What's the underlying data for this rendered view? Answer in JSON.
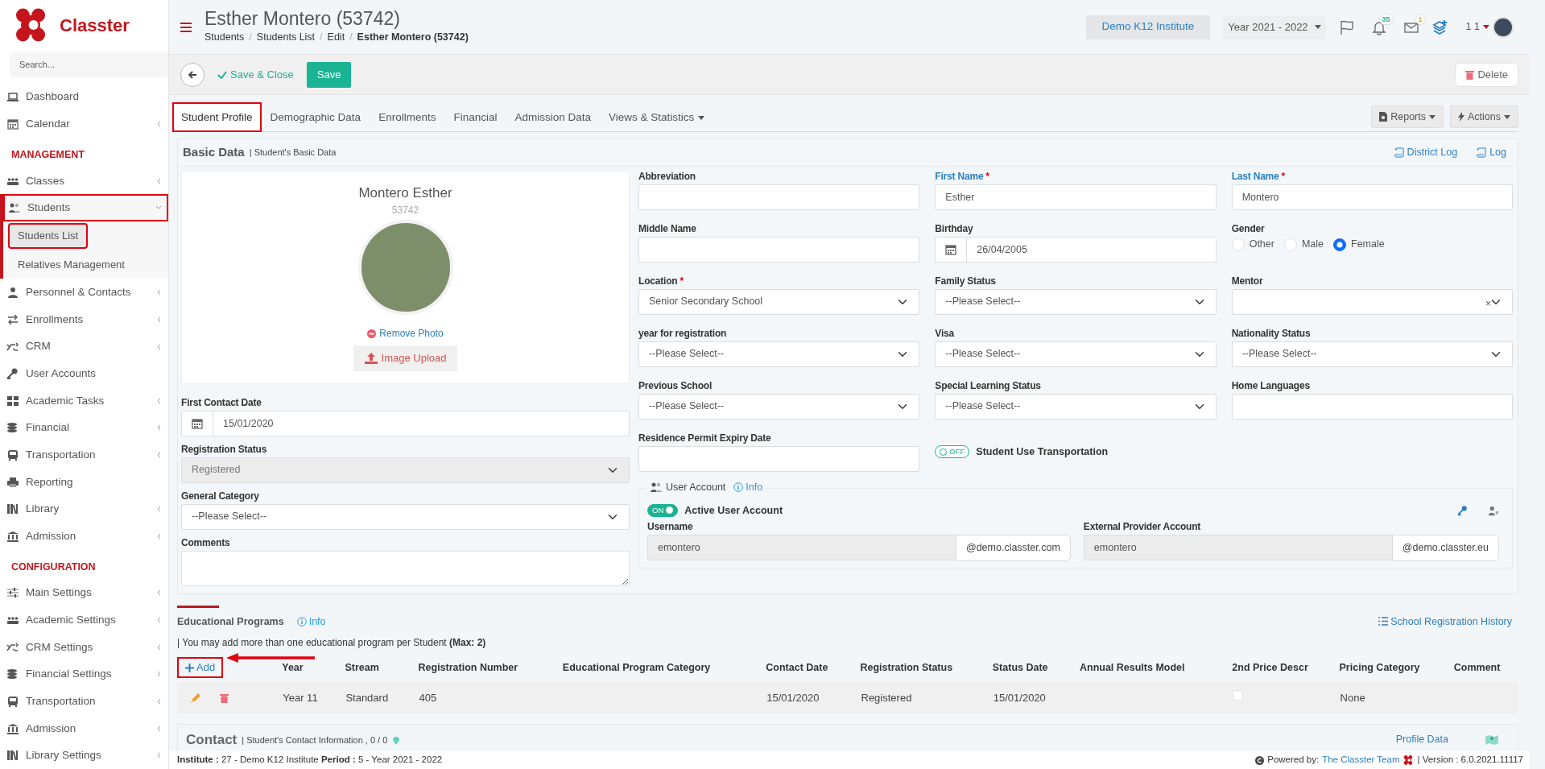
{
  "brand": {
    "name": "Classter"
  },
  "sidebar": {
    "search_placeholder": "Search...",
    "items": [
      {
        "kind": "item",
        "label": "Dashboard",
        "expandable": false,
        "expanded": false,
        "highlighted": false
      },
      {
        "kind": "item",
        "label": "Calendar",
        "expandable": true,
        "expanded": false,
        "highlighted": false
      },
      {
        "kind": "header",
        "label": "MANAGEMENT"
      },
      {
        "kind": "item",
        "label": "Classes",
        "expandable": true,
        "expanded": false,
        "highlighted": false
      },
      {
        "kind": "item",
        "label": "Students",
        "expandable": true,
        "expanded": true,
        "highlighted": true,
        "children": [
          {
            "label": "Students List",
            "selected": true,
            "highlighted": true
          },
          {
            "label": "Relatives Management",
            "selected": false,
            "highlighted": false
          }
        ]
      },
      {
        "kind": "item",
        "label": "Personnel & Contacts",
        "expandable": true,
        "expanded": false,
        "highlighted": false
      },
      {
        "kind": "item",
        "label": "Enrollments",
        "expandable": true,
        "expanded": false,
        "highlighted": false
      },
      {
        "kind": "item",
        "label": "CRM",
        "expandable": true,
        "expanded": false,
        "highlighted": false
      },
      {
        "kind": "item",
        "label": "User Accounts",
        "expandable": false,
        "expanded": false,
        "highlighted": false
      },
      {
        "kind": "item",
        "label": "Academic Tasks",
        "expandable": true,
        "expanded": false,
        "highlighted": false
      },
      {
        "kind": "item",
        "label": "Financial",
        "expandable": true,
        "expanded": false,
        "highlighted": false
      },
      {
        "kind": "item",
        "label": "Transportation",
        "expandable": true,
        "expanded": false,
        "highlighted": false
      },
      {
        "kind": "item",
        "label": "Reporting",
        "expandable": false,
        "expanded": false,
        "highlighted": false
      },
      {
        "kind": "item",
        "label": "Library",
        "expandable": true,
        "expanded": false,
        "highlighted": false
      },
      {
        "kind": "item",
        "label": "Admission",
        "expandable": true,
        "expanded": false,
        "highlighted": false
      },
      {
        "kind": "header",
        "label": "CONFIGURATION"
      },
      {
        "kind": "item",
        "label": "Main Settings",
        "expandable": true,
        "expanded": false,
        "highlighted": false
      },
      {
        "kind": "item",
        "label": "Academic Settings",
        "expandable": true,
        "expanded": false,
        "highlighted": false
      },
      {
        "kind": "item",
        "label": "CRM Settings",
        "expandable": true,
        "expanded": false,
        "highlighted": false
      },
      {
        "kind": "item",
        "label": "Financial Settings",
        "expandable": true,
        "expanded": false,
        "highlighted": false
      },
      {
        "kind": "item",
        "label": "Transportation",
        "expandable": true,
        "expanded": false,
        "highlighted": false
      },
      {
        "kind": "item",
        "label": "Admission",
        "expandable": true,
        "expanded": false,
        "highlighted": false
      },
      {
        "kind": "item",
        "label": "Library Settings",
        "expandable": true,
        "expanded": false,
        "highlighted": false
      }
    ]
  },
  "header": {
    "title": "Esther Montero (53742)",
    "breadcrumbs": [
      {
        "label": "Students",
        "separator": "/",
        "current": false
      },
      {
        "label": "Students List",
        "separator": "/",
        "current": false
      },
      {
        "label": "Edit",
        "separator": "/",
        "current": false
      },
      {
        "label": "Esther Montero (53742)",
        "current": true
      }
    ],
    "institute": "Demo K12 Institute",
    "year": "Year 2021 - 2022",
    "notifications": {
      "badge": "35",
      "color": "#1ab394"
    },
    "messages": {
      "badge": "1",
      "color": "#f0a030"
    },
    "user": "1 1"
  },
  "toolbar": {
    "save_close": "Save & Close",
    "save": "Save",
    "delete": "Delete"
  },
  "tabs": [
    {
      "label": "Student Profile",
      "selected": true,
      "highlighted": true,
      "dropdown": false
    },
    {
      "label": "Demographic Data",
      "selected": false,
      "highlighted": false,
      "dropdown": false
    },
    {
      "label": "Enrollments",
      "selected": false,
      "highlighted": false,
      "dropdown": false
    },
    {
      "label": "Financial",
      "selected": false,
      "highlighted": false,
      "dropdown": false
    },
    {
      "label": "Admission Data",
      "selected": false,
      "highlighted": false,
      "dropdown": false
    },
    {
      "label": "Views & Statistics",
      "selected": false,
      "highlighted": false,
      "dropdown": true
    }
  ],
  "tab_actions": [
    "Reports",
    "Actions"
  ],
  "basic_data": {
    "title": "Basic Data",
    "subtitle": "| Student's Basic Data",
    "links": [
      "District Log",
      "Log"
    ],
    "profile": {
      "name": "Montero Esther",
      "id": "53742",
      "remove_photo": "Remove Photo",
      "upload": "Image Upload"
    },
    "left_fields": [
      {
        "label": "First Contact Date",
        "kind": "date",
        "value": "15/01/2020"
      },
      {
        "label": "Registration Status",
        "kind": "select",
        "value": "Registered",
        "disabled": true
      },
      {
        "label": "General Category",
        "kind": "select",
        "value": "--Please Select--",
        "disabled": false
      },
      {
        "label": "Comments",
        "kind": "textarea"
      }
    ],
    "fields": [
      {
        "label": "Abbreviation",
        "kind": "text",
        "accent": false
      },
      {
        "label": "First Name",
        "required_mark": "*",
        "kind": "text",
        "value": "Esther",
        "accent": true
      },
      {
        "label": "Last Name",
        "required_mark": "*",
        "kind": "text",
        "value": "Montero",
        "accent": true
      },
      {
        "label": "Middle Name",
        "kind": "text",
        "accent": false
      },
      {
        "label": "Birthday",
        "kind": "date",
        "value": "26/04/2005",
        "accent": false
      },
      {
        "label": "Gender",
        "kind": "radio",
        "accent": false,
        "options": [
          {
            "label": "Other",
            "selected": false
          },
          {
            "label": "Male",
            "selected": false
          },
          {
            "label": "Female",
            "selected": true
          }
        ]
      },
      {
        "label": "Location",
        "required_mark": "*",
        "kind": "select",
        "value": "Senior Secondary School",
        "accent": false
      },
      {
        "label": "Family Status",
        "kind": "select",
        "value": "--Please Select--",
        "accent": false
      },
      {
        "label": "Mentor",
        "kind": "select",
        "clear_symbol": "×",
        "accent": false
      },
      {
        "label": "year for registration",
        "kind": "select",
        "value": "--Please Select--",
        "accent": false
      },
      {
        "label": "Visa",
        "kind": "select",
        "value": "--Please Select--",
        "accent": false
      },
      {
        "label": "Nationality Status",
        "kind": "select",
        "value": "--Please Select--",
        "accent": false
      },
      {
        "label": "Previous School",
        "kind": "select",
        "value": "--Please Select--",
        "accent": false
      },
      {
        "label": "Special Learning Status",
        "kind": "select",
        "value": "--Please Select--",
        "accent": false
      },
      {
        "label": "Home Languages",
        "kind": "text",
        "accent": false
      },
      {
        "label": "Residence Permit Expiry Date",
        "kind": "text",
        "accent": false
      },
      {
        "label": "Student Use Transportation",
        "kind": "toggle",
        "on": false,
        "toggle_text": "OFF"
      }
    ],
    "user_account": {
      "legend": "User Account",
      "info": "Info",
      "toggle_text": "ON",
      "on": true,
      "toggle_label": "Active User Account",
      "accounts": [
        {
          "label": "Username",
          "value": "emontero",
          "suffix": "@demo.classter.com"
        },
        {
          "label": "External Provider Account",
          "value": "emontero",
          "suffix": "@demo.classter.eu"
        }
      ]
    }
  },
  "educational_programs": {
    "title": "Educational Programs",
    "info": "Info",
    "note": "| You may add more than one educational program per Student **(Max: 2)**",
    "history_link": "School Registration History",
    "add": "Add",
    "add_highlighted": true,
    "columns": [
      "Year",
      "Stream",
      "Registration Number",
      "Educational Program Category",
      "Contact Date",
      "Registration Status",
      "Status Date",
      "Annual Results Model",
      "2nd Price Descr",
      "Pricing Category",
      "Comment"
    ],
    "rows": [
      {
        "year": "Year 11",
        "stream": "Standard",
        "registration_number": "405",
        "contact_date": "15/01/2020",
        "registration_status": "Registered",
        "status_date": "15/01/2020",
        "second_price_descr": {
          "checked": false
        },
        "pricing_category": "None"
      }
    ]
  },
  "contact": {
    "title": "Contact",
    "subtitle": "| Student's Contact Information , 0 / 0",
    "link": "Profile Data"
  },
  "footer": {
    "info": "**Institute :** 27 - Demo K12 Institute **Period :** 5 - Year 2021 - 2022",
    "powered": "Powered by:",
    "team": "The Classter Team",
    "version": "| Version : 6.0.2021.11117"
  }
}
